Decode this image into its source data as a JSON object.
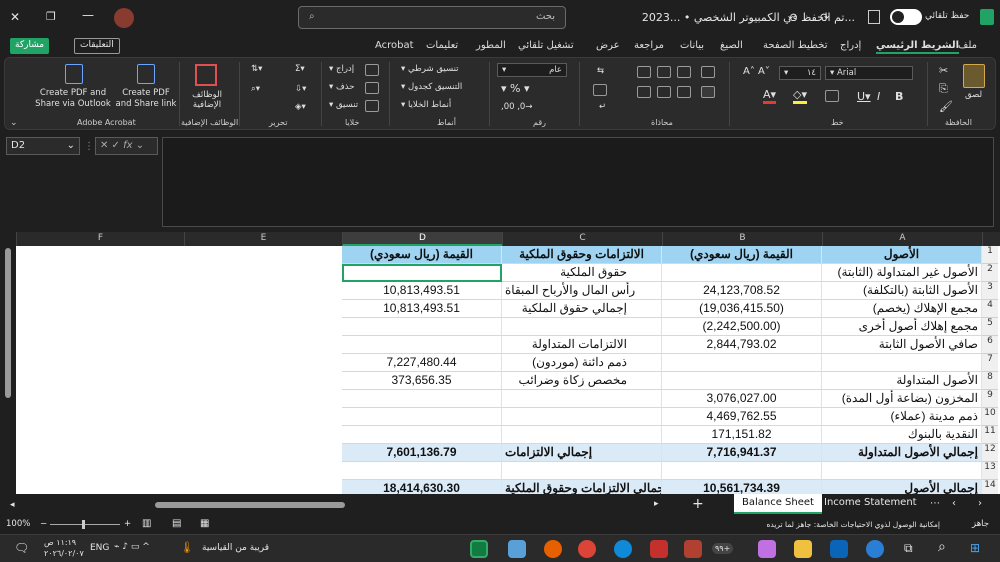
{
  "window": {
    "title": "2023... • تم الحفظ في الكمبيوتر الشخصي...",
    "autosave_label": "حفظ تلقائي",
    "search_placeholder": "بحث"
  },
  "tabs": [
    "ملف",
    "الشريط الرئيسي",
    "إدراج",
    "تخطيط الصفحة",
    "الصيغ",
    "بيانات",
    "مراجعة",
    "عرض",
    "تشغيل تلقائي",
    "المطور",
    "تعليمات",
    "Acrobat"
  ],
  "active_tab": "الشريط الرئيسي",
  "buttons": {
    "comments": "التعليقات",
    "share": "مشاركة"
  },
  "ribbon": {
    "paste": "لصق",
    "font_name": "Arial",
    "font_size": "١٤",
    "number_format": "عام",
    "conditional_formatting": "تنسيق شرطي",
    "format_as_table": "التنسيق كجدول",
    "cell_styles": "أنماط الخلايا",
    "insert": "إدراج",
    "delete": "حذف",
    "format": "تنسيق",
    "addins": "الوظائف الإضافية",
    "create_pdf_outlook": "Create PDF and Share via Outlook",
    "create_pdf_link": "Create PDF and Share link",
    "groups": {
      "clipboard": "الحافظة",
      "font": "خط",
      "alignment": "محاذاة",
      "number": "رقم",
      "styles": "أنماط",
      "cells": "خلايا",
      "editing": "تحرير",
      "addins": "الوظائف الإضافية",
      "acrobat": "Adobe Acrobat"
    }
  },
  "name_box": "D2",
  "columns": [
    "A",
    "B",
    "C",
    "D",
    "E",
    "F"
  ],
  "rows": [
    {
      "n": "1",
      "a": "الأصول",
      "b": "القيمة (ريال سعودي)",
      "c": "الالتزامات وحقوق الملكية",
      "d": "القيمة (ريال سعودي)"
    },
    {
      "n": "2",
      "a": "الأصول غير المتداولة (الثابتة)",
      "b": "",
      "c": "حقوق الملكية",
      "d": ""
    },
    {
      "n": "3",
      "a": "الأصول الثابتة (بالتكلفة)",
      "b": "24,123,708.52",
      "c": "رأس المال والأرباح المبقاة",
      "d": "10,813,493.51"
    },
    {
      "n": "4",
      "a": "(يخصم) مجمع الإهلاك",
      "b": "(19,036,415.50)",
      "c": "إجمالي حقوق الملكية",
      "d": "10,813,493.51"
    },
    {
      "n": "5",
      "a": "مجمع إهلاك أصول أخرى",
      "b": "(2,242,500.00)",
      "c": "",
      "d": ""
    },
    {
      "n": "6",
      "a": "صافي الأصول الثابتة",
      "b": "2,844,793.02",
      "c": "الالتزامات المتداولة",
      "d": ""
    },
    {
      "n": "7",
      "a": "",
      "b": "",
      "c": "ذمم دائنة (موردون)",
      "d": "7,227,480.44"
    },
    {
      "n": "8",
      "a": "الأصول المتداولة",
      "b": "",
      "c": "مخصص زكاة وضرائب",
      "d": "373,656.35"
    },
    {
      "n": "9",
      "a": "المخزون (بضاعة أول المدة)",
      "b": "3,076,027.00",
      "c": "",
      "d": ""
    },
    {
      "n": "10",
      "a": "ذمم مدينة (عملاء)",
      "b": "4,469,762.55",
      "c": "",
      "d": ""
    },
    {
      "n": "11",
      "a": "النقدية بالبنوك",
      "b": "171,151.82",
      "c": "",
      "d": ""
    },
    {
      "n": "12",
      "a": "إجمالي الأصول المتداولة",
      "b": "7,716,941.37",
      "c": "إجمالي الالتزامات",
      "d": "7,601,136.79"
    },
    {
      "n": "13",
      "a": "",
      "b": "",
      "c": "",
      "d": ""
    },
    {
      "n": "14",
      "a": "إجمالي الأصول",
      "b": "10,561,734.39",
      "c": "إجمالي الالتزامات وحقوق الملكية",
      "d": "18,414,630.30"
    }
  ],
  "sheets": [
    "Balance Sheet",
    "Income Statement"
  ],
  "active_sheet": "Balance Sheet",
  "status": {
    "ready": "جاهز",
    "accessibility": "إمكانية الوصول لذوي الاحتياجات الخاصة: جاهز لما تريده",
    "zoom": "100%"
  },
  "taskbar": {
    "weather": "قريبة من القياسية",
    "lang": "ENG",
    "time": "١١:١٩ ص",
    "date": "٢٠٢٦/٠٢/٠٧",
    "badge": "٩٩+"
  },
  "colors": {
    "header_fill": "#9fd3f2",
    "accent": "#21a366"
  }
}
